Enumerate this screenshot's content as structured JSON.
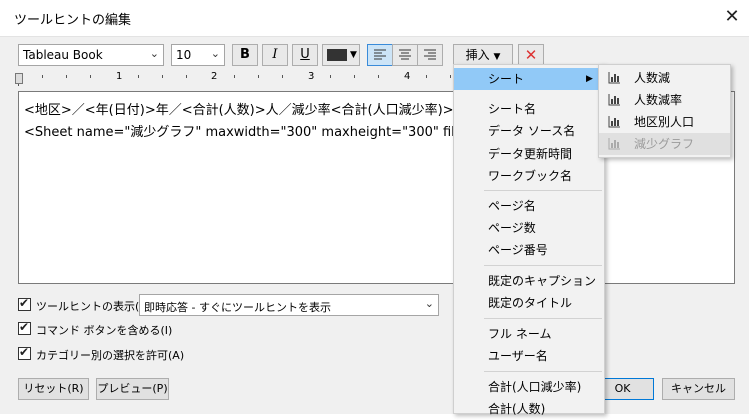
{
  "window": {
    "title": "ツールヒントの編集"
  },
  "toolbar": {
    "font": "Tableau Book",
    "size": "10",
    "bold": "B",
    "italic": "I",
    "underline": "U",
    "insert_label": "挿入",
    "font_color": "#333333",
    "accent": "#91c9f7"
  },
  "ruler": {
    "numbers": [
      "1",
      "2",
      "3",
      "4"
    ]
  },
  "editor": {
    "line1": "<地区>／<年(日付)>年／<合計(人数)>人／減少率<合計(人口減少率)>",
    "line2": "<Sheet name=\"減少グラフ\" maxwidth=\"300\" maxheight=\"300\" filte"
  },
  "options": {
    "show_tooltip": "ツールヒントの表示(S)",
    "show_mode": "即時応答 - すぐにツールヒントを表示",
    "include_command": "コマンド ボタンを含める(I)",
    "allow_category": "カテゴリー別の選択を許可(A)"
  },
  "buttons": {
    "reset": "リセット(R)",
    "preview": "プレビュー(P)",
    "ok": "OK",
    "cancel": "キャンセル"
  },
  "insert_menu": {
    "items": [
      "シート",
      "シート名",
      "データ ソース名",
      "データ更新時間",
      "ワークブック名",
      "ページ名",
      "ページ数",
      "ページ番号",
      "既定のキャプション",
      "既定のタイトル",
      "フル ネーム",
      "ユーザー名",
      "合計(人口減少率)",
      "合計(人数)"
    ]
  },
  "sheet_submenu": {
    "items": [
      "人数減",
      "人数減率",
      "地区別人口",
      "減少グラフ"
    ]
  }
}
